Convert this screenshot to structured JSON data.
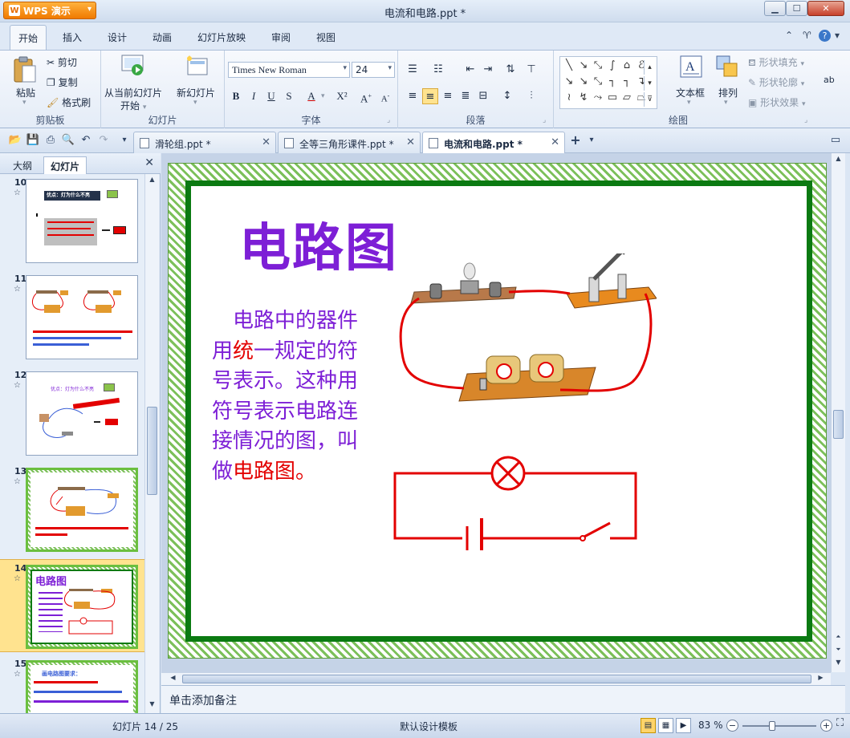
{
  "window": {
    "app_button": "WPS 演示",
    "title": "电流和电路.ppt *"
  },
  "menu": {
    "tabs": [
      "开始",
      "插入",
      "设计",
      "动画",
      "幻灯片放映",
      "审阅",
      "视图"
    ],
    "active_index": 0
  },
  "ribbon": {
    "clipboard": {
      "paste": "粘贴",
      "cut": "剪切",
      "copy": "复制",
      "format_painter": "格式刷",
      "title": "剪贴板"
    },
    "slides": {
      "from_current_line1": "从当前幻灯片",
      "from_current_line2": "开始",
      "new_slide": "新幻灯片",
      "title": "幻灯片"
    },
    "font": {
      "font_name": "Times New Roman",
      "font_size": "24",
      "bold": "B",
      "italic": "I",
      "underline": "U",
      "strike": "S",
      "color": "A",
      "superscript": "X²",
      "grow": "A",
      "shrink": "A",
      "title": "字体"
    },
    "paragraph": {
      "title": "段落"
    },
    "drawing": {
      "textbox": "文本框",
      "arrange": "排列",
      "shape_fill": "形状填充",
      "shape_outline": "形状轮廓",
      "shape_effect": "形状效果",
      "title": "绘图"
    }
  },
  "doc_tabs": [
    {
      "label": "滑轮组.ppt *",
      "active": false
    },
    {
      "label": "全等三角形课件.ppt *",
      "active": false
    },
    {
      "label": "电流和电路.ppt *",
      "active": true
    }
  ],
  "side_panel": {
    "tab_outline": "大纲",
    "tab_slides": "幻灯片",
    "slides": [
      {
        "num": "10",
        "star": "☆",
        "title": "优点：灯为什么不亮",
        "selected": false
      },
      {
        "num": "11",
        "star": "☆",
        "title": "",
        "selected": false
      },
      {
        "num": "12",
        "star": "☆",
        "title": "优点：灯为什么不亮",
        "selected": false
      },
      {
        "num": "13",
        "star": "☆",
        "title": "",
        "selected": false
      },
      {
        "num": "14",
        "star": "☆",
        "title": "电路图",
        "selected": true
      },
      {
        "num": "15",
        "star": "☆",
        "title": "画电路图要求：",
        "selected": false
      }
    ]
  },
  "slide": {
    "title": "电路图",
    "body_part1": "电路中的器件用",
    "body_red1": "统",
    "body_part2": "一规定的符号表示。这种用符号表示电路连接情况的图，叫做",
    "body_red2": "电路图。"
  },
  "notes_placeholder": "单击添加备注",
  "status": {
    "slide_counter": "幻灯片 14 / 25",
    "template": "默认设计模板",
    "zoom": "83 %"
  },
  "colors": {
    "slide_title": "#7d1fd6",
    "slide_red": "#e30000",
    "slide_border": "#0b7a12",
    "selected_thumb": "#ffe38f"
  }
}
